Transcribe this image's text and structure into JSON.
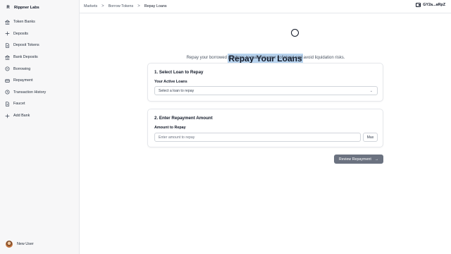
{
  "brand": {
    "name": "Rippner Labs",
    "logo": "R"
  },
  "sidebar": {
    "items": [
      {
        "label": "Token Banks",
        "icon": "bank-icon"
      },
      {
        "label": "Deposits",
        "icon": "plus-icon"
      },
      {
        "label": "Deposit Tokens",
        "icon": "file-icon"
      },
      {
        "label": "Bank Deposits",
        "icon": "bank-icon"
      },
      {
        "label": "Borrowing",
        "icon": "circle-icon"
      },
      {
        "label": "Repayment",
        "icon": "card-icon"
      },
      {
        "label": "Transaction History",
        "icon": "history-icon"
      },
      {
        "label": "Faucet",
        "icon": "file-icon"
      },
      {
        "label": "Add Bank",
        "icon": "plus-icon"
      }
    ]
  },
  "user": {
    "name": "New User"
  },
  "breadcrumb": {
    "items": [
      "Markets",
      "Borrow Tokens",
      "Repay Loans"
    ],
    "separator": ">"
  },
  "wallet": {
    "address": "GY2a...aRpZ"
  },
  "page": {
    "title": "Repay Your Loans",
    "subtitle": "Repay your borrowed positions to maintain your collateral and avoid liquidation risks."
  },
  "step1": {
    "title": "1. Select Loan to Repay",
    "field_label": "Your Active Loans",
    "select_value": "Select a loan to repay"
  },
  "step2": {
    "title": "2. Enter Repayment Amount",
    "field_label": "Amount to Repay",
    "input_placeholder": "Enter amount to repay",
    "max_label": "Max"
  },
  "actions": {
    "review_label": "Review Repayment",
    "review_arrow": "→"
  },
  "colors": {
    "accent_disabled": "#6b7280",
    "highlight": "#b7d3ee"
  }
}
